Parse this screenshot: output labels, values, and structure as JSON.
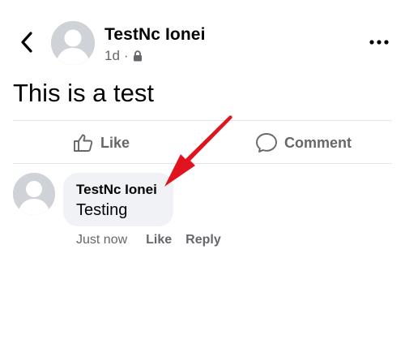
{
  "post": {
    "author_name": "TestNc Ionei",
    "time": "1d",
    "separator": "·",
    "privacy_icon": "lock-icon",
    "text": "This is a test"
  },
  "actions": {
    "like_label": "Like",
    "comment_label": "Comment"
  },
  "comment": {
    "author_name": "TestNc Ionei",
    "text": "Testing",
    "time": "Just now",
    "like_label": "Like",
    "reply_label": "Reply"
  },
  "icons": {
    "back": "chevron-left-icon",
    "more": "more-dots-icon",
    "like": "thumbs-up-icon",
    "comment": "comment-bubble-icon"
  },
  "colors": {
    "text_primary": "#050505",
    "text_secondary": "#65676b",
    "bubble_bg": "#f0f2f5",
    "divider": "#e4e6eb",
    "annotation_arrow": "#e0131f"
  }
}
